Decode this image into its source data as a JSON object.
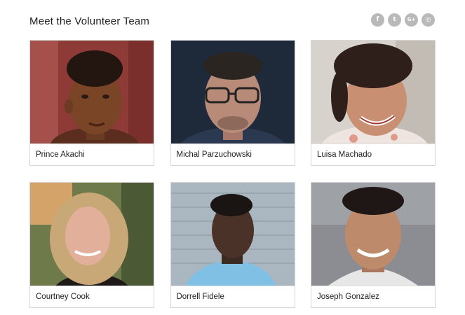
{
  "header": {
    "title": "Meet the Volunteer Team"
  },
  "social": [
    {
      "icon": "facebook-icon",
      "glyph": "f"
    },
    {
      "icon": "twitter-icon",
      "glyph": "t"
    },
    {
      "icon": "google-plus-icon",
      "glyph": "G+"
    },
    {
      "icon": "instagram-icon",
      "glyph": "◎"
    }
  ],
  "team": [
    {
      "name": "Prince Akachi"
    },
    {
      "name": "Michal Parzuchowski"
    },
    {
      "name": "Luisa Machado"
    },
    {
      "name": "Courtney Cook"
    },
    {
      "name": "Dorrell Fidele"
    },
    {
      "name": "Joseph Gonzalez"
    }
  ],
  "colors": {
    "social_button": "#b9b9b9",
    "card_border": "#d6d6d6"
  }
}
